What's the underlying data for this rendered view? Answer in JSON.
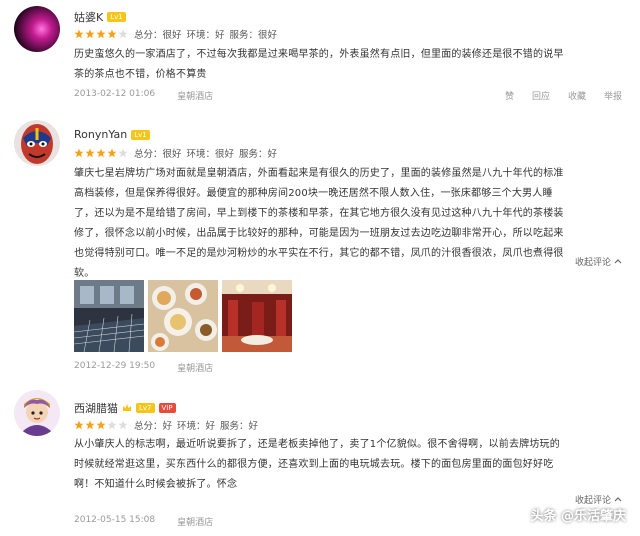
{
  "reviews": [
    {
      "username": "姑婆K",
      "level": "Lv1",
      "stars": 4,
      "ratings": [
        "总分：很好",
        "环境：好",
        "服务：很好"
      ],
      "text": "历史蛮悠久的一家酒店了，不过每次我都是过来喝早茶的，外表虽然有点旧，但里面的装修还是很不错的说早茶的茶点也不错，价格不算贵",
      "date": "2013-02-12 01:06",
      "hotel": "皇朝酒店",
      "actions": [
        "赞",
        "回应",
        "收藏",
        "举报"
      ]
    },
    {
      "username": "RonynYan",
      "level": "Lv1",
      "stars": 4,
      "ratings": [
        "总分：很好",
        "环境：很好",
        "服务：好"
      ],
      "text": "肇庆七星岩牌坊广场对面就是皇朝酒店，外面看起来是有很久的历史了，里面的装修虽然是八九十年代的标准高档装修，但是保养得很好。最便宜的那种房间200块一晚还居然不限人数入住，一张床都够三个大男人睡了，还以为是不是给错了房间，早上到楼下的茶楼和早茶，在其它地方很久没有见过这种八九十年代的茶楼装修了，很怀念以前小时候，出品属于比较好的那种，可能是因为一班朋友过去边吃边聊非常开心，所以吃起来也觉得特别可口。唯一不足的是炒河粉炒的水平实在不行，其它的都不错，凤爪的汁很香很浓，凤爪也煮得很软。",
      "fold": "收起评论",
      "date": "2012-12-29 19:50",
      "hotel": "皇朝酒店"
    },
    {
      "username": "西湖腊猫",
      "level": "Lv7",
      "vip": "VIP",
      "stars": 3,
      "ratings": [
        "总分：好",
        "环境：好",
        "服务：好"
      ],
      "text": "从小肇庆人的标志啊，最近听说要拆了，还是老板卖掉他了，卖了1个亿貌似。很不舍得啊，以前去牌坊玩的时候就经常逛这里，买东西什么的都很方便，还喜欢到上面的电玩城去玩。楼下的面包房里面的面包好好吃啊！不知道什么时候会被拆了。怀念",
      "fold": "收起评论",
      "date": "2012-05-15 15:08",
      "hotel": "皇朝酒店"
    }
  ],
  "watermark": "头条 @乐活肇庆",
  "colors": {
    "star": "#f7a21b",
    "star_empty": "#dddddd",
    "level": "#f5c518",
    "vip": "#e94a3a"
  }
}
